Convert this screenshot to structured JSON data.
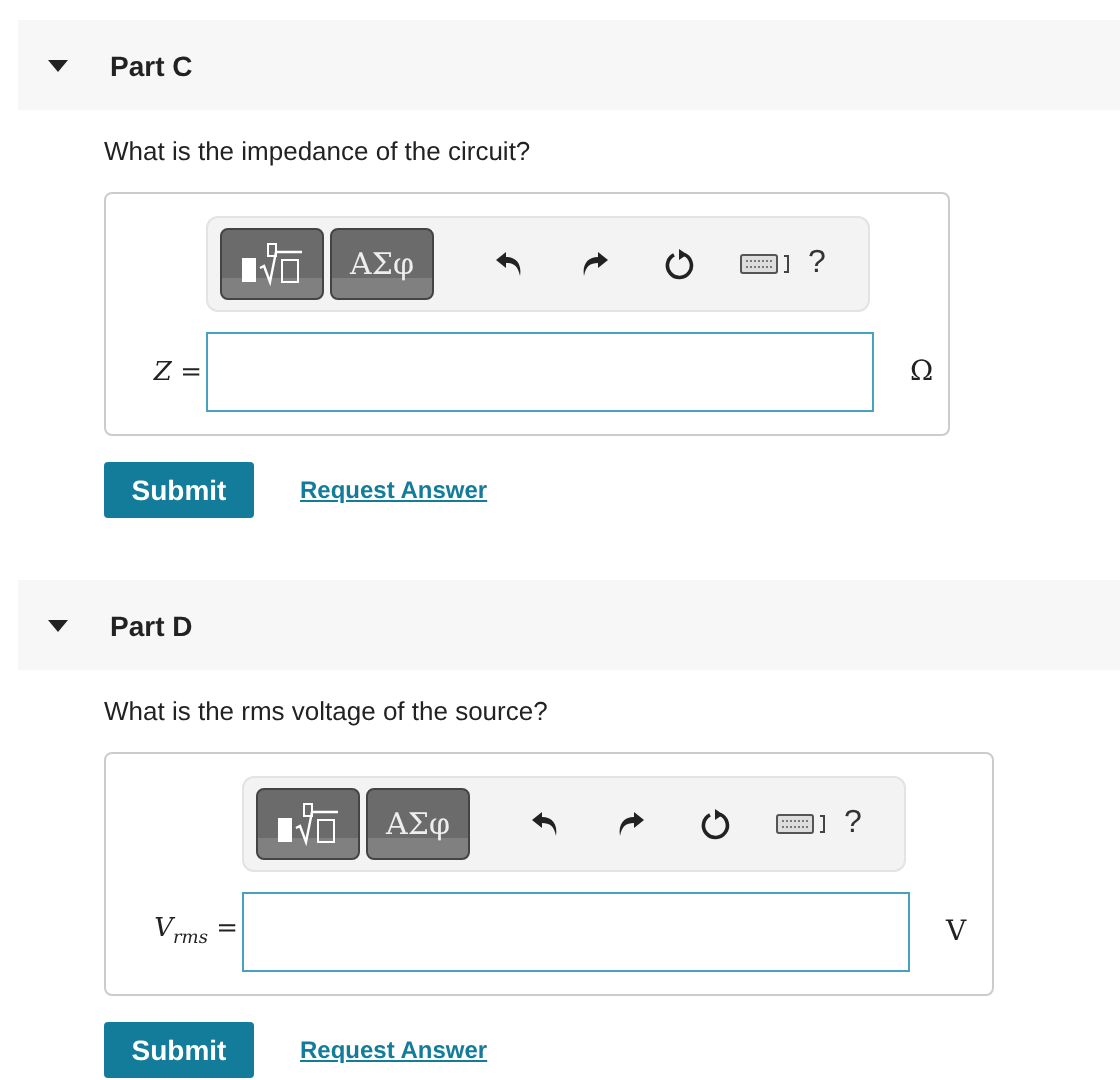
{
  "parts": [
    {
      "title": "Part C",
      "expanded": true,
      "question": "What is the impedance of the circuit?",
      "toolbar": {
        "symbols": "ΑΣφ",
        "help": "?"
      },
      "label": "*Z* =",
      "unit": "Ω",
      "submit": "Submit",
      "request": "Request Answer"
    },
    {
      "title": "Part D",
      "expanded": true,
      "question": "What is the rms voltage of the source?",
      "toolbar": {
        "symbols": "ΑΣφ",
        "help": "?"
      },
      "label": "*V*$_{rms}$ =",
      "unit": "V",
      "submit": "Submit",
      "request": "Request Answer"
    }
  ]
}
